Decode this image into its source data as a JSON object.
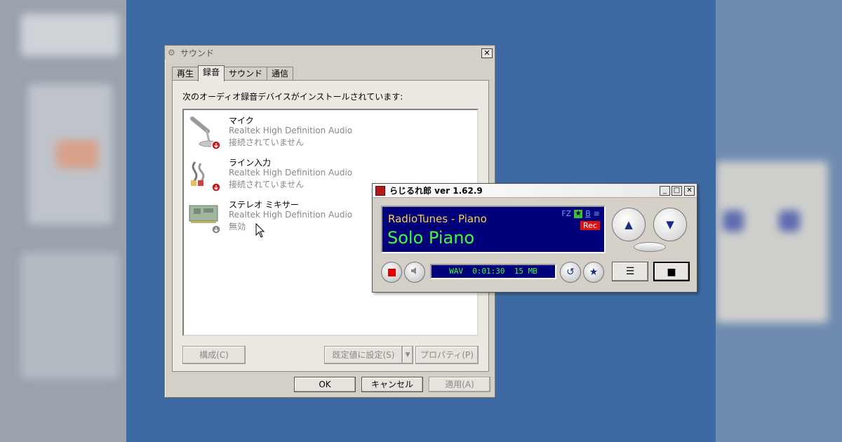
{
  "colors": {
    "desktop": "#3d6aa3",
    "lcd_bg": "#00007a",
    "lcd_song": "#3cfe3c",
    "lcd_station": "#ffd24a",
    "rec_badge": "#e01010"
  },
  "sound_dialog": {
    "title": "サウンド",
    "close_label": "✕",
    "tabs": [
      {
        "label": "再生",
        "active": false
      },
      {
        "label": "録音",
        "active": true
      },
      {
        "label": "サウンド",
        "active": false
      },
      {
        "label": "通信",
        "active": false
      }
    ],
    "description": "次のオーディオ録音デバイスがインストールされています:",
    "devices": [
      {
        "name": "マイク",
        "driver": "Realtek High Definition Audio",
        "status": "接続されていません",
        "icon": "microphone-icon"
      },
      {
        "name": "ライン入力",
        "driver": "Realtek High Definition Audio",
        "status": "接続されていません",
        "icon": "line-in-cable-icon"
      },
      {
        "name": "ステレオ ミキサー",
        "driver": "Realtek High Definition Audio",
        "status": "無効",
        "icon": "sound-card-icon"
      }
    ],
    "buttons": {
      "configure": "構成(C)",
      "set_default": "既定値に設定(S)",
      "properties": "プロパティ(P)",
      "ok": "OK",
      "cancel": "キャンセル",
      "apply": "適用(A)"
    }
  },
  "radio_app": {
    "title": "らじるれ郎 ver 1.62.9",
    "station": "RadioTunes - Piano",
    "song": "Solo Piano",
    "flags": {
      "fz": "FZ",
      "star": "★",
      "b": "B",
      "menu": "≡"
    },
    "rec_badge": "Rec",
    "status_line": "WAV  0:01:30  15 MB",
    "window_buttons": {
      "minimize": "_",
      "maximize": "□",
      "close": "✕"
    },
    "icons": {
      "record": "record-button",
      "mute": "speaker-icon",
      "reload": "↺",
      "favorite": "★",
      "up": "▲",
      "down": "▼",
      "menu": "☰",
      "stop": "■"
    }
  }
}
